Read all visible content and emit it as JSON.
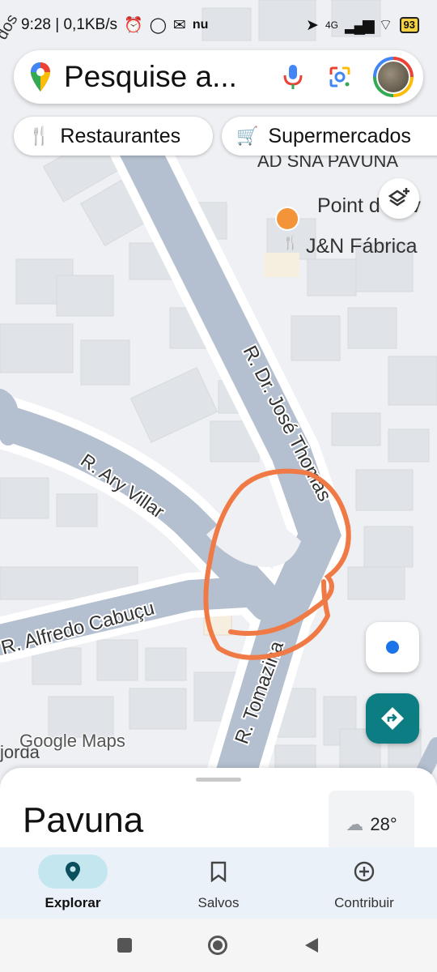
{
  "status_bar": {
    "time_speed": "9:28 | 0,1KB/s",
    "app_icons": [
      "alarm-icon",
      "whatsapp-icon",
      "gmail-icon",
      "nu-icon"
    ],
    "nu_label": "nu",
    "network": "4G",
    "battery": "93"
  },
  "search": {
    "placeholder": "Pesquise a..."
  },
  "chips": [
    {
      "label": "Restaurantes",
      "icon": "fork-knife-icon"
    },
    {
      "label": "Supermercados",
      "icon": "cart-icon"
    }
  ],
  "map": {
    "streets": {
      "dr_jose_thomas": "R. Dr. José Thomas",
      "ary_villar": "R. Ary Villar",
      "alfredo_cabucu": "R. Alfredo Cabuçu",
      "tomazina": "R. Tomazina",
      "top_partial": "AD SNA PAVUNA"
    },
    "pois": {
      "point": "Point d Pav",
      "jn": "J&N Fábrica"
    },
    "partial_labels": {
      "top_left": "dos",
      "bottom_left": "jorda"
    },
    "watermark": "Google Maps",
    "annotation_color": "#f07a45"
  },
  "bottom_sheet": {
    "title": "Pavuna",
    "weather_temp": "28°"
  },
  "nav": [
    {
      "label": "Explorar",
      "icon": "pin-icon",
      "active": true
    },
    {
      "label": "Salvos",
      "icon": "bookmark-icon",
      "active": false
    },
    {
      "label": "Contribuir",
      "icon": "plus-circle-icon",
      "active": false
    }
  ],
  "colors": {
    "accent": "#0c7d83",
    "nav_active": "#c4e7ef",
    "blue_dot": "#1a73e8"
  }
}
